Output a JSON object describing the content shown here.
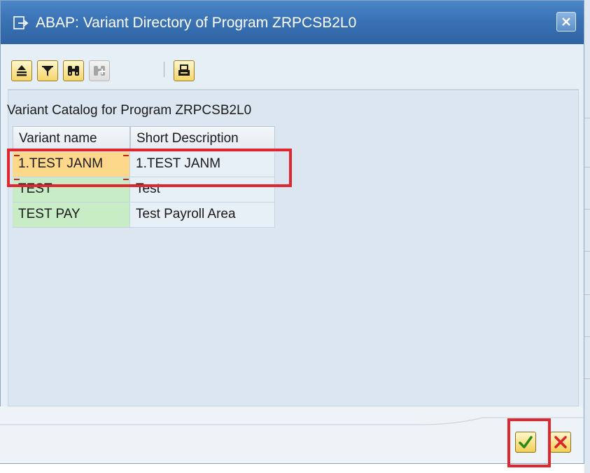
{
  "window": {
    "title": "ABAP: Variant Directory of Program ZRPCSB2L0"
  },
  "toolbar": {
    "buttons": [
      {
        "icon": "sort-ascending-icon"
      },
      {
        "icon": "filter-icon"
      },
      {
        "icon": "find-icon"
      },
      {
        "icon": "find-next-icon",
        "disabled": true
      },
      {
        "icon": "print-icon"
      }
    ]
  },
  "catalog": {
    "title": "Variant Catalog for Program ZRPCSB2L0",
    "columns": [
      "Variant name",
      "Short Description"
    ],
    "rows": [
      {
        "name": "1.TEST JANM",
        "description": "1.TEST JANM",
        "selected": true
      },
      {
        "name": "TEST",
        "description": "Test"
      },
      {
        "name": "TEST PAY",
        "description": "Test Payroll Area"
      }
    ]
  },
  "footer": {
    "ok_icon": "checkmark-icon",
    "cancel_icon": "cancel-x-icon"
  },
  "colors": {
    "title_bar": "#3a73b5",
    "highlight": "#e0262e",
    "name_cell": "#c8ecc6",
    "selected_cell": "#fdd78a"
  }
}
